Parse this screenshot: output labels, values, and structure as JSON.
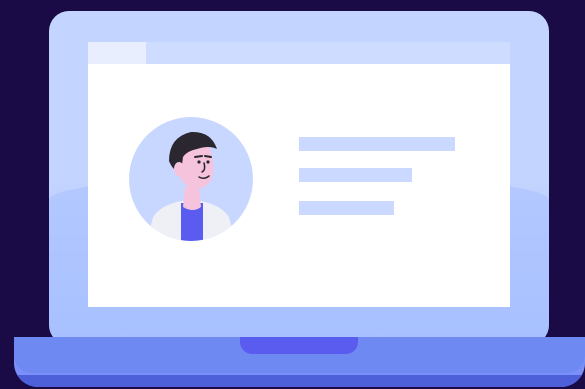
{
  "illustration": {
    "subject": "laptop-profile-card",
    "colors": {
      "background": "#1a0a45",
      "lid": "#c3d4ff",
      "window": "#ffffff",
      "window_bar": "#cddcff",
      "text_placeholder": "#cbd8ff",
      "base": "#6f89f3",
      "notch": "#5a5cf0",
      "avatar_bg": "#c8d7ff",
      "skin": "#f6c3dd",
      "hair": "#2b2730",
      "shirt": "#5a5cf0",
      "jacket": "#eef0f6"
    },
    "icons": [
      "user-avatar-icon"
    ]
  }
}
